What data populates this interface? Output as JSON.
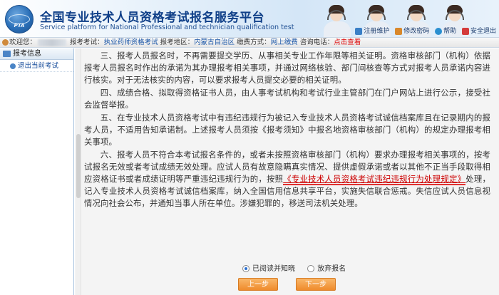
{
  "header": {
    "title_cn": "全国专业技术人员资格考试报名服务平台",
    "title_en": "Service platform for National Professional and technician qualification test",
    "logo_text": "PTA",
    "links": [
      {
        "label": "注册维护",
        "icon": "register-icon",
        "color": "#3a7fc6"
      },
      {
        "label": "修改密码",
        "icon": "password-icon",
        "color": "#d9882b"
      },
      {
        "label": "帮助",
        "icon": "help-icon",
        "color": "#2a8fd0"
      },
      {
        "label": "安全退出",
        "icon": "logout-icon",
        "color": "#d43b3b"
      }
    ]
  },
  "infobar": {
    "welcome": "欢迎您：",
    "exam_label": "报考考试：",
    "exam_value": "执业药师资格考试",
    "region_label": "报考地区：",
    "region_value": "内蒙古自治区",
    "method_label": "缴费方式：",
    "method_value": "网上缴费",
    "phone_label": "咨询电话：",
    "phone_link": "点击查看"
  },
  "sidebar": {
    "title": "报考信息",
    "items": [
      {
        "label": "退出当前考试"
      }
    ]
  },
  "content": {
    "p1": "三、报考人员报名时，不再需要提交学历、从事相关专业工作年限等相关证明。资格审核部门（机构）依据报考人员报名时作出的承诺为其办理报考相关事项，并通过网络核验、部门间核查等方式对报考人员承诺内容进行核实。对于无法核实的内容，可以要求报考人员提交必要的相关证明。",
    "p2": "四、成绩合格、拟取得资格证书人员，由人事考试机构和考试行业主管部门在门户网站上进行公示，接受社会监督举报。",
    "p3": "五、在专业技术人员资格考试中有违纪违规行为被记入专业技术人员资格考试诚信档案库且在记录期内的报考人员，不适用告知承诺制。上述报考人员须按《报考须知》中报名地资格审核部门（机构）的规定办理报考相关事项。",
    "p4_a": "六、报考人员不符合本考试报名条件的，或者未按照资格审核部门（机构）要求办理报考相关事项的，按考试报名无效或者考试成绩无效处理。应试人员有故意隐瞒真实情况、提供虚假承诺或者以其他不正当手段取得相应资格证书或者成绩证明等严重违纪违规行为的，按照",
    "p4_link": "《专业技术人员资格考试违纪违规行为处理规定》",
    "p4_b": "处理，记入专业技术人员资格考试诚信档案库，纳入全国信用信息共享平台，实施失信联合惩戒。失信应试人员信息视情况向社会公布，并通知当事人所在单位。涉嫌犯罪的，移送司法机关处理。"
  },
  "agreement": {
    "read_label": "已阅读并知晓",
    "abandon_label": "放弃报名",
    "selected": "已阅读并知晓"
  },
  "buttons": {
    "prev": "上一步",
    "next": "下一步"
  },
  "colors": {
    "accent": "#1a56a8",
    "link_red": "#c00000",
    "button_orange": "#ef8b2c"
  }
}
